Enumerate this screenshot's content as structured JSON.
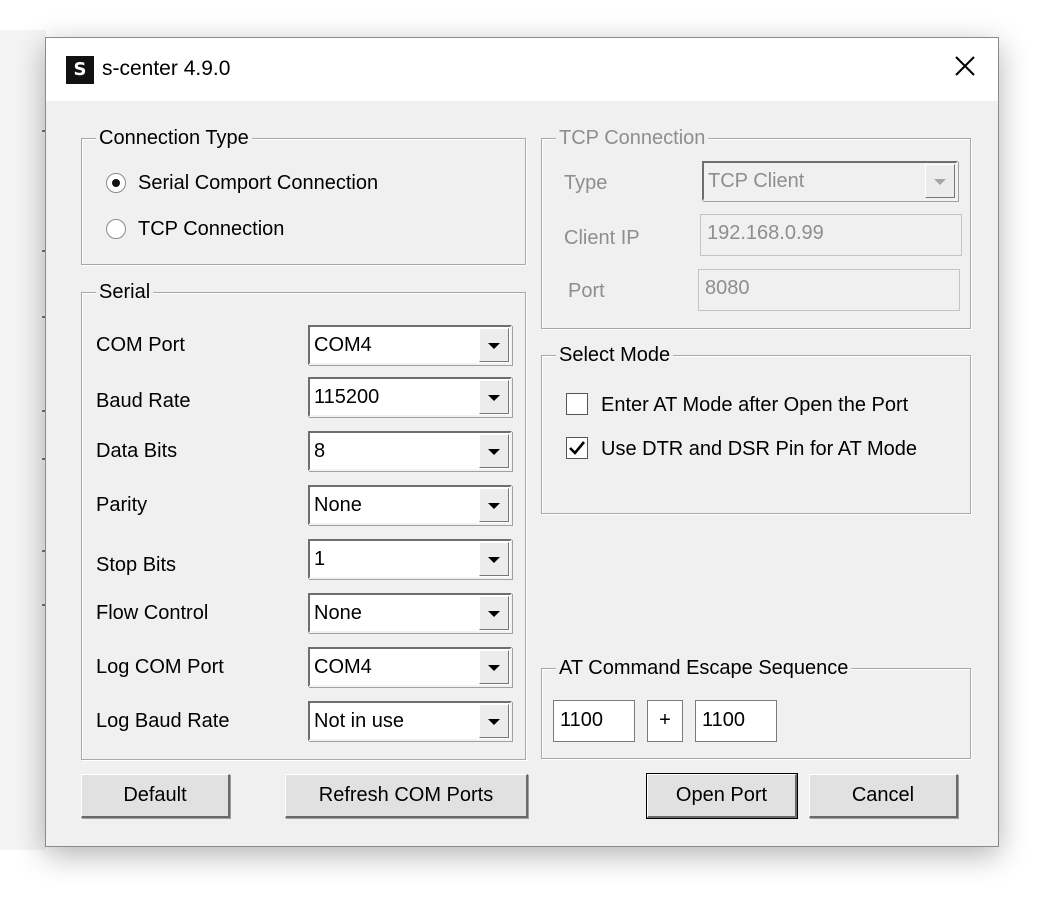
{
  "window": {
    "title": "s-center 4.9.0",
    "icon_letter": "S",
    "close_icon": "close-icon"
  },
  "connection_type": {
    "legend": "Connection Type",
    "options": [
      {
        "label": "Serial Comport Connection",
        "selected": true
      },
      {
        "label": "TCP Connection",
        "selected": false
      }
    ]
  },
  "serial": {
    "legend": "Serial",
    "fields": [
      {
        "label": "COM Port",
        "value": "COM4"
      },
      {
        "label": "Baud Rate",
        "value": "115200"
      },
      {
        "label": "Data Bits",
        "value": "8"
      },
      {
        "label": "Parity",
        "value": "None"
      },
      {
        "label": "Stop Bits",
        "value": "1"
      },
      {
        "label": "Flow Control",
        "value": "None"
      },
      {
        "label": "Log COM Port",
        "value": "COM4"
      },
      {
        "label": "Log Baud Rate",
        "value": "Not in use"
      }
    ]
  },
  "tcp": {
    "legend": "TCP Connection",
    "enabled": false,
    "type_label": "Type",
    "type_value": "TCP Client",
    "client_ip_label": "Client IP",
    "client_ip_value": "192.168.0.99",
    "port_label": "Port",
    "port_value": "8080"
  },
  "select_mode": {
    "legend": "Select Mode",
    "options": [
      {
        "label": "Enter AT Mode after Open the Port",
        "checked": false
      },
      {
        "label": "Use DTR and DSR Pin for AT Mode",
        "checked": true
      }
    ]
  },
  "escape_sequence": {
    "legend": "AT Command Escape Sequence",
    "before": "1100",
    "plus": "+",
    "after": "1100"
  },
  "buttons": {
    "default": "Default",
    "refresh": "Refresh COM Ports",
    "open": "Open Port",
    "cancel": "Cancel"
  }
}
